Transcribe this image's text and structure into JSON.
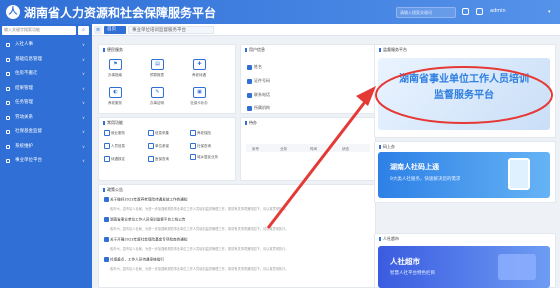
{
  "header": {
    "title": "湖南省人力资源和社会保障服务平台",
    "search_placeholder": "请输入搜索关键词",
    "user": "admin"
  },
  "sidebar": {
    "search_placeholder": "输入关键字搜索功能",
    "items": [
      "入社人事",
      "基础信息管理",
      "住房不搬迁",
      "结果管理",
      "任务管理",
      "劳动关系",
      "社保基金监督",
      "系统维护",
      "事业单位平台"
    ]
  },
  "tabs": {
    "home": "首页",
    "page": "事业单位培训监督服务平台"
  },
  "common_services": {
    "title": "便民服务",
    "items": [
      "办事指南",
      "预算报表",
      "养老待遇",
      "养老服务",
      "办事证明",
      "社保卡补办"
    ]
  },
  "user_info": {
    "title": "用户信息",
    "rows": [
      "姓名",
      "证件号码",
      "联系电话",
      "所属机构"
    ]
  },
  "functions": {
    "title": "常用功能",
    "items": [
      "就业服务",
      "信息采集",
      "养老保险",
      "人员信息",
      "单位参保",
      "社保查询",
      "待遇核定",
      "医保查询",
      "城乡居民业务"
    ]
  },
  "tasks": {
    "title": "待办",
    "headers": [
      "序号",
      "业务",
      "时间",
      "状态"
    ]
  },
  "notices": {
    "title": "政策公告",
    "items": [
      {
        "title": "关于做好2023年度养老保险待遇发放工作的通知",
        "desc": "各市州，县市区人社局，为进一步加强和规范事业单位工作人员培训监督管理工作，现将有关事项通知如下，请认真贯彻执行。"
      },
      {
        "title": "湖南省事业单位工作人员培训监督平台上线公告",
        "desc": "各市州，县市区人社局，为进一步加强和规范事业单位工作人员培训监督管理工作，现将有关事项通知如下，请认真贯彻执行。"
      },
      {
        "title": "关于开展2023年度社会保险基金专项检查的通知",
        "desc": "各市州，县市区人社局，为进一步加强和规范事业单位工作人员培训监督管理工作，现将有关事项通知如下，请认真贯彻执行。"
      },
      {
        "title": "社保重点，工作人员待遇审核指引",
        "desc": "各市州，县市区人社局，为进一步加强和规范事业单位工作人员培训监督管理工作，现将有关事项通知如下，请认真贯彻执行。"
      }
    ]
  },
  "right_panels": {
    "platform": {
      "title": "监督服务平台",
      "line1": "湖南省事业单位工作人员培训",
      "line2": "监督服务平台"
    },
    "app": {
      "title": "码上办",
      "headline": "湖南人社码上通",
      "sub": "9大类人社服务，快速解决您的需求"
    },
    "market": {
      "title": "人社超市",
      "headline": "人社超市",
      "sub": "智慧人社平台特色栏目"
    }
  },
  "colors": {
    "primary": "#2f6fd6",
    "arrow": "#e53935"
  }
}
